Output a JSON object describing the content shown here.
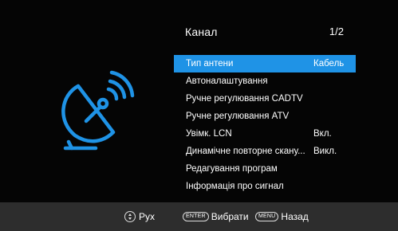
{
  "header": {
    "title": "Канал",
    "page_indicator": "1/2"
  },
  "menu": {
    "items": [
      {
        "label": "Тип антени",
        "value": "Кабель"
      },
      {
        "label": "Автоналаштування"
      },
      {
        "label": "Ручне регулювання CADTV"
      },
      {
        "label": "Ручне регулювання ATV"
      },
      {
        "label": "Увімк. LCN",
        "value": "Вкл."
      },
      {
        "label": "Динамічне повторне скану...",
        "value": "Викл."
      },
      {
        "label": "Редагування програм"
      },
      {
        "label": "Інформація про сигнал"
      }
    ],
    "selected_index": 0
  },
  "footer": {
    "move_label": "Рух",
    "enter_key": "ENTER",
    "enter_label": "Вибрати",
    "menu_key": "MENU",
    "menu_label": "Назад"
  },
  "icons": {
    "section_icon": "satellite-dish-icon",
    "move_icon": "up-down-arrows-icon"
  },
  "colors": {
    "accent": "#1f93e6",
    "background": "#050505",
    "footer_bg": "#2d2d2d",
    "text": "#ffffff"
  }
}
